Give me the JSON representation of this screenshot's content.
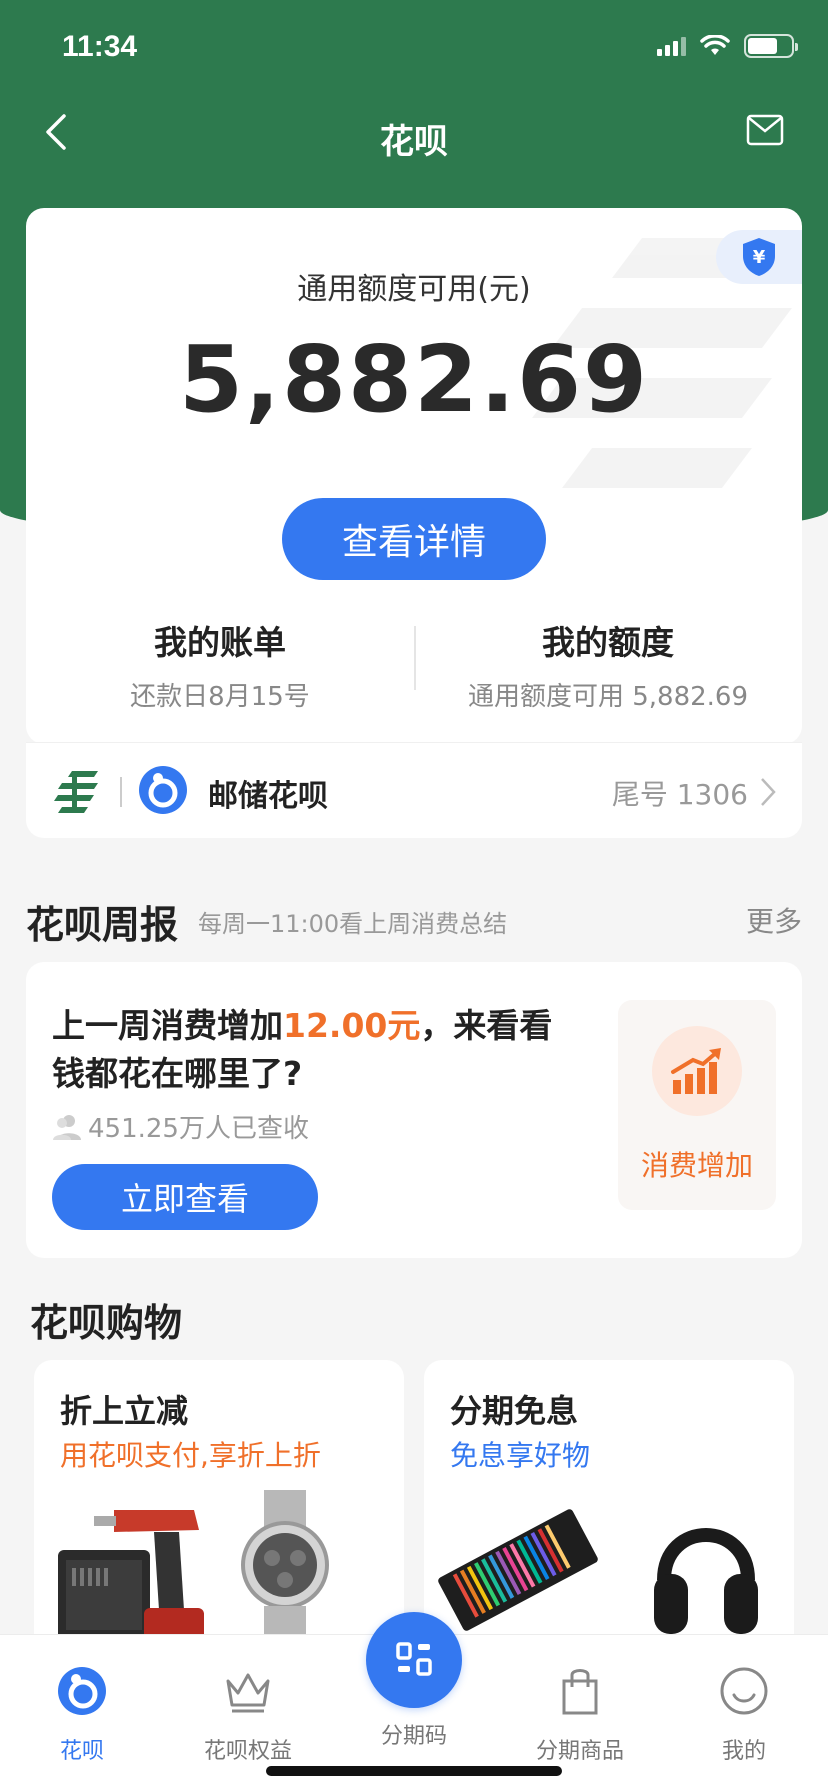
{
  "status_bar": {
    "time": "11:34"
  },
  "nav": {
    "title": "花呗"
  },
  "credit_card": {
    "label": "通用额度可用(元)",
    "amount": "5,882.69",
    "detail_button": "查看详情",
    "bill": {
      "title": "我的账单",
      "subtitle": "还款日8月15号"
    },
    "quota": {
      "title": "我的额度",
      "subtitle": "通用额度可用 5,882.69"
    }
  },
  "bank": {
    "name": "邮储花呗",
    "tail": "尾号 1306"
  },
  "weekly": {
    "title": "花呗周报",
    "subtitle": "每周一11:00看上周消费总结",
    "more": "更多",
    "text_before": "上一周消费增加",
    "highlight": "12.00元",
    "text_after": "，来看看钱都花在哪里了?",
    "readers": "451.25万人已查收",
    "button": "立即查看",
    "badge_label": "消费增加"
  },
  "shopping": {
    "title": "花呗购物",
    "cards": [
      {
        "title": "折上立减",
        "subtitle": "用花呗支付,享折上折"
      },
      {
        "title": "分期免息",
        "subtitle": "免息享好物"
      }
    ]
  },
  "tabs": [
    {
      "label": "花呗",
      "icon": "huabei-icon"
    },
    {
      "label": "花呗权益",
      "icon": "crown-icon"
    },
    {
      "label": "分期码",
      "icon": "qr-code-icon"
    },
    {
      "label": "分期商品",
      "icon": "shopping-bag-icon"
    },
    {
      "label": "我的",
      "icon": "smiley-icon"
    }
  ],
  "colors": {
    "header_green": "#2d7a4e",
    "primary_blue": "#3478f0",
    "accent_orange": "#f0702a"
  }
}
